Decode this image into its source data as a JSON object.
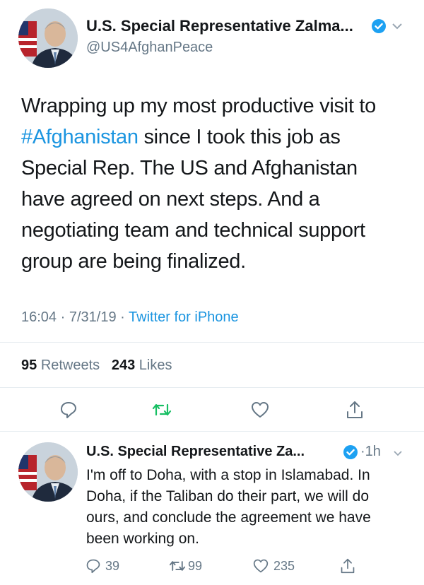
{
  "main_tweet": {
    "author_name": "U.S. Special Representative Zalma...",
    "handle": "@US4AfghanPeace",
    "text_before": "Wrapping up my most productive visit to ",
    "hashtag": "#Afghanistan",
    "text_after": " since I took this job as Special Rep. The US and Afghanistan have agreed on next steps. And a negotiating team and technical support group are being finalized.",
    "time": "16:04",
    "date": "7/31/19",
    "source": "Twitter for iPhone",
    "separator": "·",
    "retweets_count": "95",
    "retweets_label": "Retweets",
    "likes_count": "243",
    "likes_label": "Likes"
  },
  "reply_tweet": {
    "author_name": "U.S. Special Representative Za...",
    "time_ago": "1h",
    "separator": "·",
    "text": "I'm off to Doha, with a stop in Islamabad. In Doha, if the Taliban do their part, we will do ours, and conclude the agreement we have been working on.",
    "reply_count": "39",
    "retweet_count": "99",
    "like_count": "235"
  },
  "colors": {
    "accent": "#1b95e0",
    "retweet_green": "#17bf63",
    "muted": "#657786"
  },
  "icons": [
    "verified-badge-icon",
    "chevron-down-icon",
    "reply-icon",
    "retweet-icon",
    "like-icon",
    "share-icon"
  ]
}
